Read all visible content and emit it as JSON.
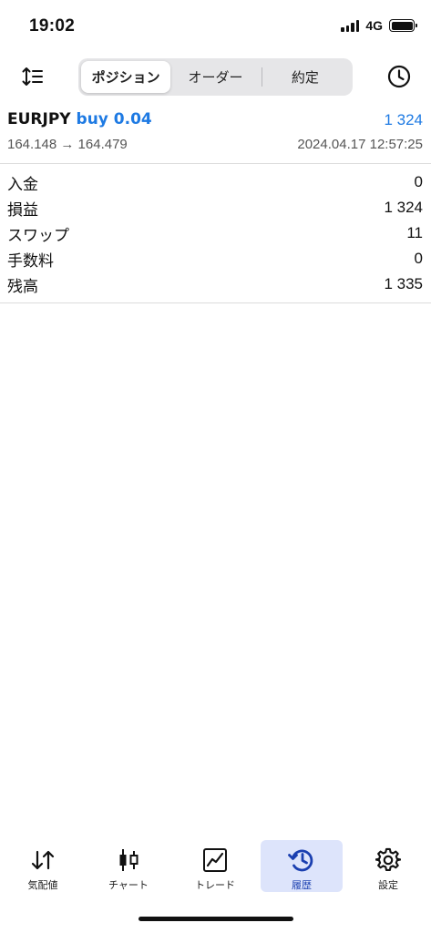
{
  "status": {
    "time": "19:02",
    "network": "4G"
  },
  "segments": [
    {
      "label": "ポジション",
      "active": true
    },
    {
      "label": "オーダー",
      "active": false
    },
    {
      "label": "約定",
      "active": false
    }
  ],
  "position": {
    "symbol": "EURJPY",
    "direction": "buy 0.04",
    "profit": "1 324",
    "prices": "164.148 → 164.479",
    "time": "2024.04.17 12:57:25"
  },
  "summary": [
    {
      "label": "入金",
      "value": "0"
    },
    {
      "label": "損益",
      "value": "1 324"
    },
    {
      "label": "スワップ",
      "value": "11"
    },
    {
      "label": "手数料",
      "value": "0"
    },
    {
      "label": "残高",
      "value": "1 335"
    }
  ],
  "tabs": [
    {
      "label": "気配値",
      "icon": "quotes-icon",
      "active": false
    },
    {
      "label": "チャート",
      "icon": "chart-candles-icon",
      "active": false
    },
    {
      "label": "トレード",
      "icon": "trade-chart-icon",
      "active": false
    },
    {
      "label": "履歴",
      "icon": "history-icon",
      "active": true
    },
    {
      "label": "設定",
      "icon": "gear-icon",
      "active": false
    }
  ],
  "colors": {
    "accent": "#1e7ae3",
    "tab_active_bg": "#dde4fb",
    "tab_active_fg": "#1a3fb0"
  }
}
